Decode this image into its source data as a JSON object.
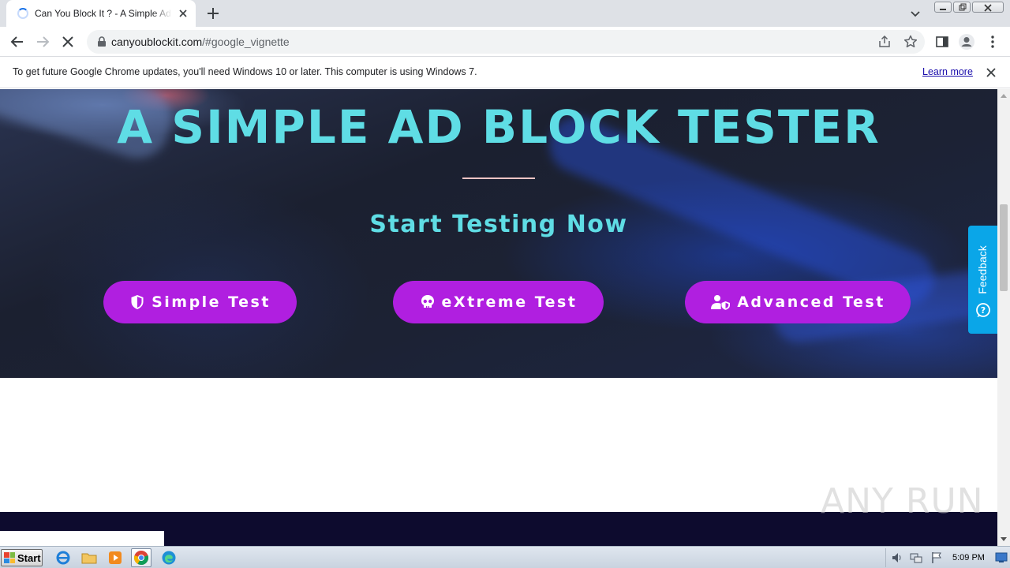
{
  "browser": {
    "tab": {
      "title": "Can You Block It ? - A Simple Ad Block Tester"
    },
    "address": {
      "host": "canyoublockit.com",
      "path": "/#google_vignette"
    },
    "infobar": {
      "message": "To get future Google Chrome updates, you'll need Windows 10 or later. This computer is using Windows 7.",
      "link": "Learn more"
    }
  },
  "page": {
    "headline": "A SIMPLE AD BLOCK TESTER",
    "subheadline": "Start Testing Now",
    "buttons": [
      {
        "label": "Simple Test",
        "icon": "shield-icon"
      },
      {
        "label": "eXtreme Test",
        "icon": "skull-icon"
      },
      {
        "label": "Advanced Test",
        "icon": "user-shield-icon"
      }
    ],
    "feedback": "Feedback",
    "colors": {
      "accent_text": "#5fdde5",
      "button": "#b01fe0",
      "feedback": "#0aa6e8"
    }
  },
  "watermark": "ANY RUN",
  "taskbar": {
    "start": "Start",
    "clock": "5:09 PM"
  }
}
